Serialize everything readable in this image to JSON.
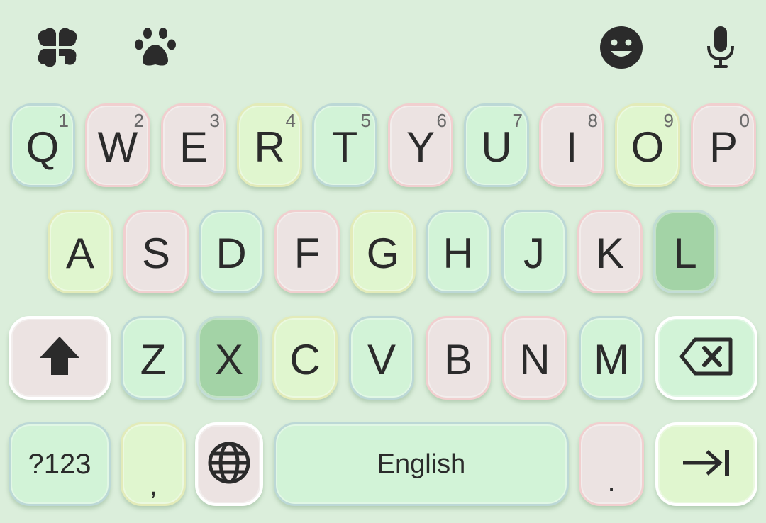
{
  "toolbar": {
    "left_icons": [
      "clover-icon",
      "paw-icon"
    ],
    "right_icons": [
      "emoji-icon",
      "microphone-icon"
    ]
  },
  "rows": [
    [
      {
        "label": "Q",
        "hint": "1"
      },
      {
        "label": "W",
        "hint": "2"
      },
      {
        "label": "E",
        "hint": "3"
      },
      {
        "label": "R",
        "hint": "4"
      },
      {
        "label": "T",
        "hint": "5"
      },
      {
        "label": "Y",
        "hint": "6"
      },
      {
        "label": "U",
        "hint": "7"
      },
      {
        "label": "I",
        "hint": "8"
      },
      {
        "label": "O",
        "hint": "9"
      },
      {
        "label": "P",
        "hint": "0"
      }
    ],
    [
      {
        "label": "A"
      },
      {
        "label": "S"
      },
      {
        "label": "D"
      },
      {
        "label": "F"
      },
      {
        "label": "G"
      },
      {
        "label": "H"
      },
      {
        "label": "J"
      },
      {
        "label": "K"
      },
      {
        "label": "L"
      }
    ],
    [
      {
        "label": "Z"
      },
      {
        "label": "X"
      },
      {
        "label": "C"
      },
      {
        "label": "V"
      },
      {
        "label": "B"
      },
      {
        "label": "N"
      },
      {
        "label": "M"
      }
    ]
  ],
  "bottom": {
    "symbols": "?123",
    "comma": ",",
    "space": "English",
    "period": "."
  },
  "colors": {
    "background": "#dbeedb",
    "key_green": "#d2f3d7",
    "key_pink": "#ece3e2",
    "key_lime": "#e0f6cf",
    "key_dark": "#a3d3a6"
  }
}
